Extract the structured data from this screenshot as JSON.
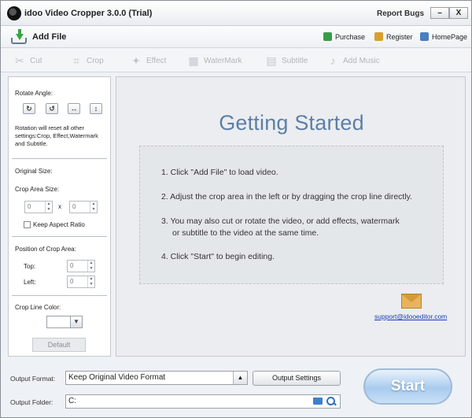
{
  "window": {
    "title": "idoo Video Cropper 3.0.0 (Trial)",
    "report_bugs": "Report Bugs",
    "minimize_symbol": "–",
    "close_symbol": "X"
  },
  "toolbar_top": {
    "add_file": "Add File",
    "purchase": "Purchase",
    "register": "Register",
    "homepage": "HomePage"
  },
  "tools": [
    {
      "label": "Cut",
      "icon": "scissors-icon"
    },
    {
      "label": "Crop",
      "icon": "crop-icon"
    },
    {
      "label": "Effect",
      "icon": "effect-icon"
    },
    {
      "label": "WaterMark",
      "icon": "watermark-icon"
    },
    {
      "label": "Subtitle",
      "icon": "subtitle-icon"
    },
    {
      "label": "Add Music",
      "icon": "music-icon"
    }
  ],
  "left_panel": {
    "rotate_angle_label": "Rotate Angle:",
    "rotate_note": "Rotation will reset all other settings:Crop, Effect,Watermark and Subtitle.",
    "original_size_label": "Original Size:",
    "crop_area_size_label": "Crop Area Size:",
    "width_value": "0",
    "height_value": "0",
    "x_separator": "x",
    "keep_aspect_label": "Keep Aspect Ratio",
    "keep_aspect_checked": false,
    "position_label": "Position of Crop Area:",
    "top_label": "Top:",
    "top_value": "0",
    "left_label": "Left:",
    "left_value": "0",
    "crop_line_color_label": "Crop Line Color:",
    "default_button": "Default"
  },
  "main": {
    "heading": "Getting Started",
    "step1": "1. Click \"Add File\" to load video.",
    "step2": "2. Adjust the crop area in the left or by dragging the crop line directly.",
    "step3_line1": "3. You may also cut or rotate the video, or add effects, watermark",
    "step3_line2": "or subtitle to the video at the same time.",
    "step4": "4. Click \"Start\" to begin editing.",
    "support_email": "support@idooeditor.com"
  },
  "bottom": {
    "output_format_label": "Output Format:",
    "output_format_value": "Keep Original Video Format",
    "output_settings_button": "Output Settings",
    "output_folder_label": "Output Folder:",
    "output_folder_value": "C:",
    "start_button": "Start"
  },
  "colors": {
    "accent_heading": "#5d7fa6",
    "link": "#1a3fb0",
    "start_button": "#a9cbee"
  }
}
